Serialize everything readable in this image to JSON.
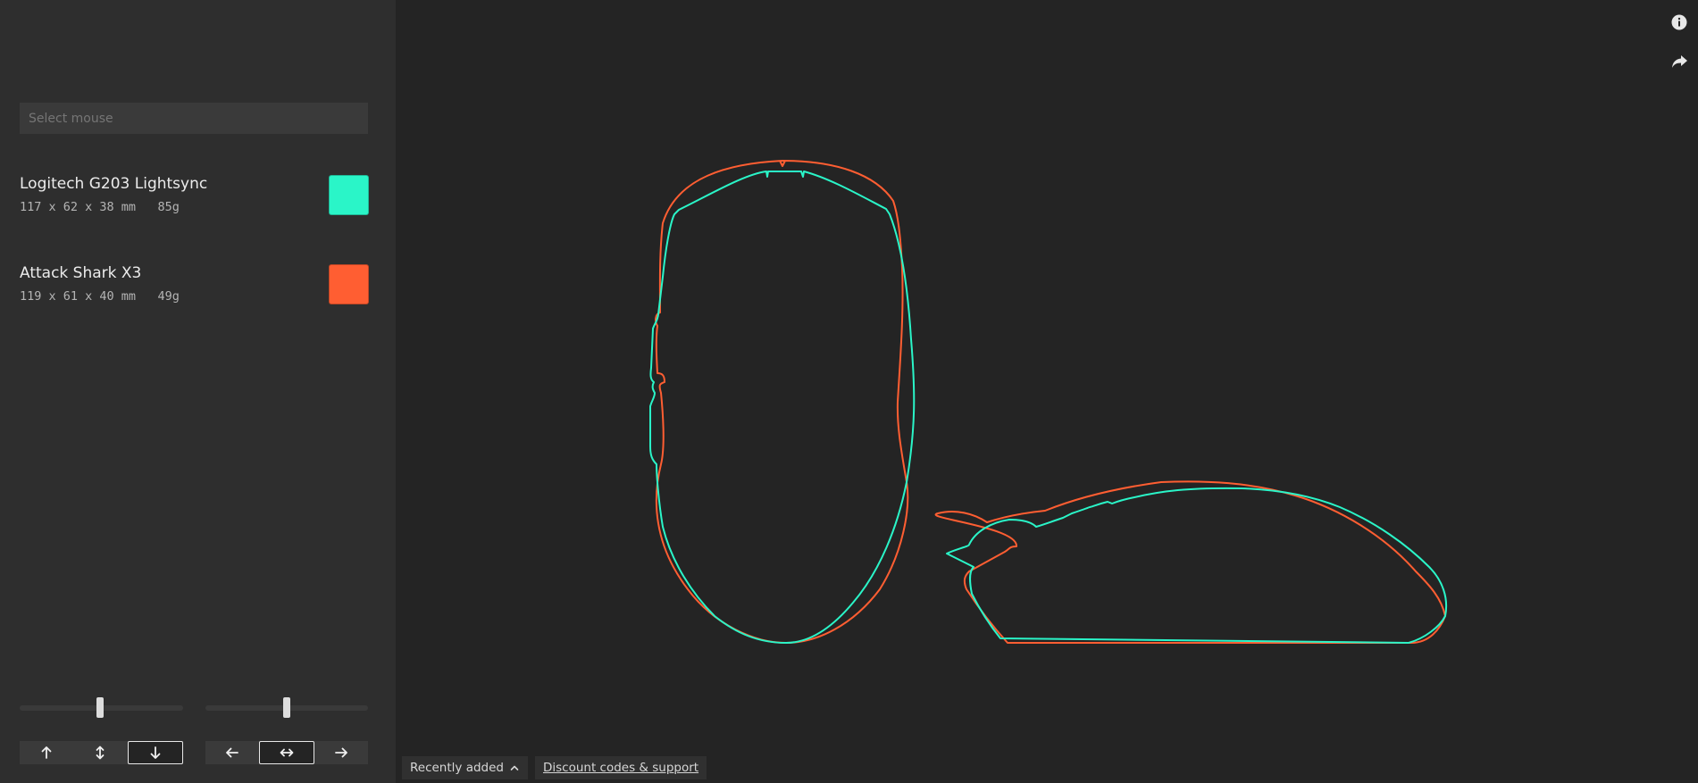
{
  "search": {
    "placeholder": "Select mouse"
  },
  "mice": [
    {
      "name": "Logitech G203 Lightsync",
      "dimensions": "117 x 62 x 38 mm",
      "weight": "85g",
      "color": "#2af5c8"
    },
    {
      "name": "Attack Shark X3",
      "dimensions": "119 x 61 x 40 mm",
      "weight": "49g",
      "color": "#ff5e32"
    }
  ],
  "controls": {
    "vertical_slider_value": 0.5,
    "horizontal_slider_value": 0.5,
    "vertical_buttons": [
      {
        "icon": "arrow-up-icon",
        "label": "↑",
        "active": false
      },
      {
        "icon": "arrow-up-down-icon",
        "label": "↕",
        "active": false
      },
      {
        "icon": "arrow-down-icon",
        "label": "↓",
        "active": true
      }
    ],
    "horizontal_buttons": [
      {
        "icon": "arrow-left-icon",
        "label": "←",
        "active": false
      },
      {
        "icon": "arrow-left-right-icon",
        "label": "↔",
        "active": true
      },
      {
        "icon": "arrow-right-icon",
        "label": "→",
        "active": false
      }
    ]
  },
  "toolbar": {
    "info_icon": "info-icon",
    "share_icon": "share-icon"
  },
  "footer": {
    "sort_label": "Recently added",
    "sort_icon": "chevron-up-icon",
    "support_link": "Discount codes & support"
  },
  "colors": {
    "background": "#242424",
    "sidebar": "#2e2e2e",
    "teal": "#2af5c8",
    "orange": "#ff5e32"
  }
}
